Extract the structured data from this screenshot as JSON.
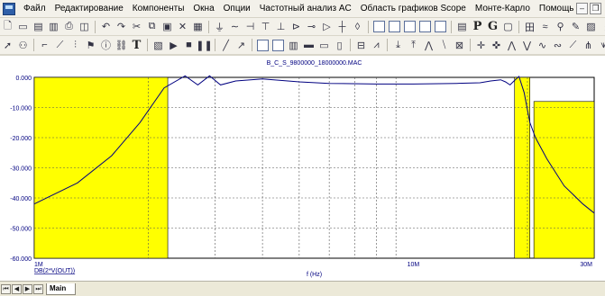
{
  "menubar": {
    "items": [
      "Файл",
      "Редактирование",
      "Компоненты",
      "Окна",
      "Опции",
      "Частотный анализ AC",
      "Область графиков Scope",
      "Монте-Карло",
      "Помощь"
    ],
    "minimize": "–",
    "restore": "❐"
  },
  "toolbar1": {
    "icons": [
      "new-icon",
      "open-icon",
      "save-icon",
      "save-all-icon",
      "print-icon",
      "print-preview-icon",
      "undo-icon",
      "redo-icon",
      "cut-icon",
      "copy-icon",
      "paste-icon",
      "delete-icon",
      "grid-icon",
      "component-icons",
      "wire-icons",
      "window-icons",
      "text-P",
      "text-G"
    ],
    "letter_p": "P",
    "letter_g": "G"
  },
  "toolbar2": {
    "text_t": "T"
  },
  "toolbar3": {
    "text_p": "P'",
    "text_f": "F"
  },
  "chart_data": {
    "type": "line",
    "title": "B_C_S_9800000_18000000.MAC",
    "xlabel": "f (Hz)",
    "x_scale": "log",
    "xlim": [
      1000000,
      30000000
    ],
    "ylim": [
      -60,
      0
    ],
    "x_ticks": [
      "1M",
      "10M",
      "30M"
    ],
    "y_ticks": [
      "0.000",
      "-10.000",
      "-20.000",
      "-30.000",
      "-40.000",
      "-50.000",
      "-60.000"
    ],
    "grid": true,
    "series": [
      {
        "name": "DB(2*V(OUT))",
        "color": "#000080",
        "x": [
          1000000,
          1300000,
          1600000,
          1900000,
          2200000,
          2500000,
          2700000,
          2900000,
          3100000,
          3400000,
          4000000,
          5000000,
          6000000,
          8000000,
          10000000,
          13000000,
          15000000,
          16000000,
          17000000,
          17500000,
          18000000,
          18500000,
          19000000,
          19600000,
          20300000,
          21000000,
          22500000,
          25000000,
          28000000,
          30000000
        ],
        "y": [
          -42,
          -35,
          -26,
          -15,
          -3.5,
          0.5,
          -2.5,
          0.5,
          -2.5,
          -1.2,
          -0.5,
          -1.5,
          -2,
          -2.2,
          -2.2,
          -2,
          -1.8,
          -1.2,
          -0.8,
          -1.5,
          -2.5,
          -1,
          0.3,
          -5,
          -15,
          -20,
          -27,
          -36,
          -42,
          -45
        ]
      }
    ],
    "highlight_bands": [
      {
        "x_from": 1000000,
        "x_to": 2250000,
        "y_from": -60,
        "y_to": 0,
        "color": "#ffff00"
      },
      {
        "x_from": 20800000,
        "x_to": 30000000,
        "y_from": -60,
        "y_to": -8,
        "color": "#ffff00"
      },
      {
        "x_from": 18500000,
        "x_to": 20300000,
        "y_from": -60,
        "y_to": 0,
        "color": "#ffff00"
      }
    ]
  },
  "tabs": {
    "nav": [
      "⏮",
      "◀",
      "▶",
      "⏭"
    ],
    "active": "Main"
  }
}
